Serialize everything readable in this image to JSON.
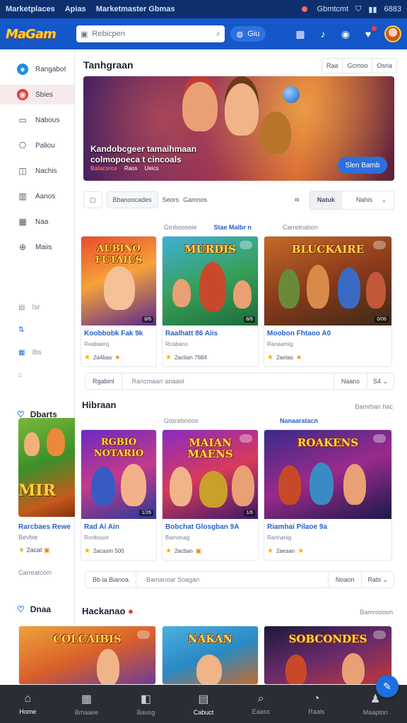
{
  "topstrip": {
    "left": [
      "Marketplaces",
      "Apias",
      "Marketmaster Gbmas"
    ],
    "notify": "Gbmtcmt",
    "time": "6883"
  },
  "header": {
    "logo": "MaGam",
    "search_placeholder": "Rebicpen",
    "pill": "Giu"
  },
  "sidebar": {
    "items": [
      {
        "label": "Rangabot",
        "icon": "●"
      },
      {
        "label": "Sbies",
        "icon": "◉"
      },
      {
        "label": "Nabous",
        "icon": "▭"
      },
      {
        "label": "Paliou",
        "icon": "⎔"
      },
      {
        "label": "Nachis",
        "icon": "◫"
      },
      {
        "label": "Aanos",
        "icon": "▥"
      },
      {
        "label": "Naa",
        "icon": "▦"
      },
      {
        "label": "Maiis",
        "icon": "⊕"
      }
    ],
    "mini": [
      {
        "label": "Isr",
        "icon": "▤"
      },
      {
        "label": "",
        "icon": "⇅"
      },
      {
        "label": "Ibs",
        "icon": "▦"
      },
      {
        "label": "",
        "icon": "⌂"
      }
    ],
    "section1": "Dbarts",
    "side_card_title": "Rarcbaes Rewe",
    "side_card_sub": "Bevbie",
    "side_card_foot": "2acat",
    "side_note": "Carreatcom",
    "section2": "Dnaa"
  },
  "main": {
    "title": "Tanhgraan",
    "tbtns": [
      "Raa",
      "Gcmoo",
      "Osria"
    ],
    "hero": {
      "line1": "Kandobcgeer tamaihmaan",
      "line2": "colmopoeca t cincoals",
      "tag": "Balacsrce",
      "meta1": "Raos",
      "meta2": "Ueics",
      "button": "Slen Bamb"
    },
    "filters": {
      "chip1": "Bbanoocades",
      "chip2": "Seors",
      "chip3": "Gamnos",
      "seg_on": "Natuk",
      "seg_off": "Nahis"
    },
    "row1_meta": {
      "left": "Gtnbooooie",
      "mid": "Stae Malbr n",
      "right": "Carretnabon"
    },
    "row1_cards": [
      {
        "title": "Koobbobk Fak 9k",
        "sub": "Reabaerq",
        "foot": "2a4bas",
        "art": "AUBINO FUTAIUS",
        "badge": "8/6"
      },
      {
        "title": "Raalhatt 86 Aiis",
        "sub": "Rcabano",
        "foot": "2actian 7684",
        "art": "MURDIS",
        "badge": "8/6"
      },
      {
        "title": "Moobon Fhtaoo A0",
        "sub": "Ranaamig",
        "foot": "2aetas",
        "art": "BLUCKAIRE",
        "badge": "0/06"
      }
    ],
    "pagebar1": {
      "a": "Rgabinl",
      "b": "Rancmaarr anaaoi",
      "c": "Naans",
      "d": "S4"
    },
    "section2": {
      "title": "Hibraan",
      "right": "Bamrban hac"
    },
    "row2_meta": {
      "left": "Gtocebnoos",
      "right": "Nanaaratacn"
    },
    "row2_cards": [
      {
        "title": "Rad Ai Ain",
        "sub": "Ronbouor",
        "foot": "2acasm 500",
        "art": "RGBIO NOTARIO",
        "badge": "1/26"
      },
      {
        "title": "Bobchat Glosgban 9A",
        "sub": "Bamonag",
        "foot": "2actian",
        "art": "MAIAN MAENS",
        "badge": "1/6"
      },
      {
        "title": "Riamhai Pilaoe 9a",
        "sub": "Rannanig",
        "foot": "2aesan",
        "art": "ROAKENS",
        "badge": ""
      }
    ],
    "pagebar2": {
      "a": "Bb ia Bianoa",
      "b": "Bamanoar Soagan",
      "c": "Noaon",
      "d": "Rabi"
    },
    "section3": {
      "title": "Hackanao",
      "right": "Bamroooon"
    },
    "row3_cards": [
      {
        "art": "COLCAIBIS"
      },
      {
        "art": "NAKAN"
      },
      {
        "art": "SOBCONDES"
      }
    ]
  },
  "bottom": [
    {
      "label": "Home",
      "icon": "⌂"
    },
    {
      "label": "Bmaaee",
      "icon": "▦"
    },
    {
      "label": "Bausg",
      "icon": "◧"
    },
    {
      "label": "Cabuct",
      "icon": "▤"
    },
    {
      "label": "Eaass",
      "icon": "⌕"
    },
    {
      "label": "Raals",
      "icon": "◔"
    },
    {
      "label": "Maapton",
      "icon": "♟"
    }
  ],
  "fab_icon": "✎"
}
